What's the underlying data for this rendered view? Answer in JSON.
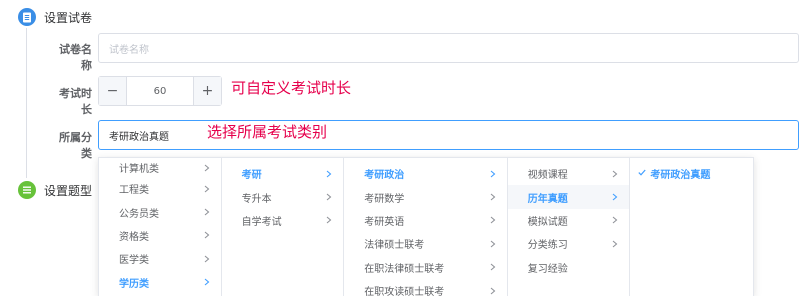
{
  "steps": {
    "set_paper": "设置试卷",
    "set_question_type": "设置题型"
  },
  "form": {
    "paper_name": {
      "label": "试卷名称",
      "placeholder": "试卷名称"
    },
    "duration": {
      "label": "考试时长",
      "value": "60",
      "minus": "−",
      "plus": "+"
    },
    "category": {
      "label": "所属分类",
      "value": "考研政治真题"
    }
  },
  "annotations": {
    "duration_note": "可自定义考试时长",
    "category_note": "选择所属考试类别"
  },
  "cascader": {
    "col1": [
      "计算机类",
      "工程类",
      "公务员类",
      "资格类",
      "医学类",
      "学历类"
    ],
    "col2": [
      "考研",
      "专升本",
      "自学考试"
    ],
    "col3": [
      "考研政治",
      "考研数学",
      "考研英语",
      "法律硕士联考",
      "在职法律硕士联考",
      "在职攻读硕士联考"
    ],
    "col4": [
      "视频课程",
      "历年真题",
      "模拟试题",
      "分类练习",
      "复习经验"
    ],
    "col5": [
      "考研政治真题"
    ]
  },
  "colors": {
    "primary": "#409eff",
    "step_blue": "#3a8ee6",
    "step_green": "#67c23a",
    "annotation": "#e6004c"
  }
}
